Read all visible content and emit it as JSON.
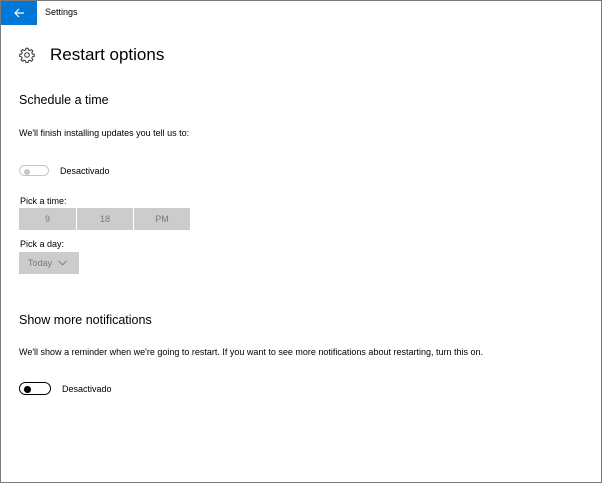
{
  "window": {
    "title": "Settings"
  },
  "page": {
    "title": "Restart options"
  },
  "schedule": {
    "heading": "Schedule a time",
    "description": "We'll finish installing updates you tell us to:",
    "toggle_label": "Desactivado",
    "time_label": "Pick a time:",
    "time": {
      "hour": "9",
      "minute": "18",
      "period": "PM"
    },
    "day_label": "Pick a day:",
    "day_value": "Today"
  },
  "notifications": {
    "heading": "Show more notifications",
    "description": "We'll show a reminder when we're going to restart. If you want to see more notifications about restarting, turn this on.",
    "toggle_label": "Desactivado"
  },
  "colors": {
    "accent": "#0078d7",
    "disabled_fill": "#cccccc",
    "disabled_text": "#7a7a7a"
  },
  "icons": {
    "back": "back-arrow-icon",
    "settings": "gear-icon",
    "dropdown": "chevron-down-icon"
  }
}
